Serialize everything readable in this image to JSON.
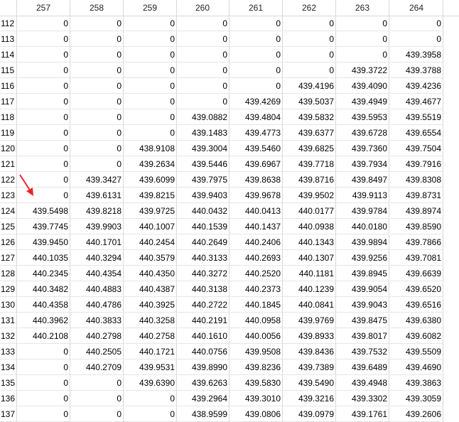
{
  "columns": [
    "257",
    "258",
    "259",
    "260",
    "261",
    "262",
    "263",
    "264"
  ],
  "rows": [
    {
      "index": "112",
      "values": [
        "0",
        "0",
        "0",
        "0",
        "0",
        "0",
        "0",
        "0"
      ]
    },
    {
      "index": "113",
      "values": [
        "0",
        "0",
        "0",
        "0",
        "0",
        "0",
        "0",
        "0"
      ]
    },
    {
      "index": "114",
      "values": [
        "0",
        "0",
        "0",
        "0",
        "0",
        "0",
        "0",
        "439.3958"
      ]
    },
    {
      "index": "115",
      "values": [
        "0",
        "0",
        "0",
        "0",
        "0",
        "0",
        "439.3722",
        "439.3788"
      ]
    },
    {
      "index": "116",
      "values": [
        "0",
        "0",
        "0",
        "0",
        "0",
        "439.4196",
        "439.4090",
        "439.4236"
      ]
    },
    {
      "index": "117",
      "values": [
        "0",
        "0",
        "0",
        "0",
        "439.4269",
        "439.5037",
        "439.4949",
        "439.4677"
      ]
    },
    {
      "index": "118",
      "values": [
        "0",
        "0",
        "0",
        "439.0882",
        "439.4804",
        "439.5832",
        "439.5953",
        "439.5519"
      ]
    },
    {
      "index": "119",
      "values": [
        "0",
        "0",
        "0",
        "439.1483",
        "439.4773",
        "439.6377",
        "439.6728",
        "439.6554"
      ]
    },
    {
      "index": "120",
      "values": [
        "0",
        "0",
        "438.9108",
        "439.3004",
        "439.5460",
        "439.6825",
        "439.7360",
        "439.7504"
      ]
    },
    {
      "index": "121",
      "values": [
        "0",
        "0",
        "439.2634",
        "439.5446",
        "439.6967",
        "439.7718",
        "439.7934",
        "439.7916"
      ]
    },
    {
      "index": "122",
      "values": [
        "0",
        "439.3427",
        "439.6099",
        "439.7975",
        "439.8638",
        "439.8716",
        "439.8497",
        "439.8308"
      ]
    },
    {
      "index": "123",
      "values": [
        "0",
        "439.6131",
        "439.8215",
        "439.9403",
        "439.9678",
        "439.9502",
        "439.9113",
        "439.8731"
      ]
    },
    {
      "index": "124",
      "values": [
        "439.5498",
        "439.8218",
        "439.9725",
        "440.0432",
        "440.0413",
        "440.0177",
        "439.9784",
        "439.8974"
      ]
    },
    {
      "index": "125",
      "values": [
        "439.7745",
        "439.9903",
        "440.1007",
        "440.1539",
        "440.1437",
        "440.0938",
        "440.0180",
        "439.8590"
      ]
    },
    {
      "index": "126",
      "values": [
        "439.9450",
        "440.1701",
        "440.2454",
        "440.2649",
        "440.2406",
        "440.1343",
        "439.9894",
        "439.7866"
      ]
    },
    {
      "index": "127",
      "values": [
        "440.1035",
        "440.3294",
        "440.3579",
        "440.3133",
        "440.2693",
        "440.1307",
        "439.9256",
        "439.7081"
      ]
    },
    {
      "index": "128",
      "values": [
        "440.2345",
        "440.4354",
        "440.4350",
        "440.3272",
        "440.2520",
        "440.1181",
        "439.8945",
        "439.6639"
      ]
    },
    {
      "index": "129",
      "values": [
        "440.3482",
        "440.4883",
        "440.4387",
        "440.3138",
        "440.2373",
        "440.1239",
        "439.9054",
        "439.6520"
      ]
    },
    {
      "index": "130",
      "values": [
        "440.4358",
        "440.4786",
        "440.3925",
        "440.2722",
        "440.1845",
        "440.0841",
        "439.9043",
        "439.6516"
      ]
    },
    {
      "index": "131",
      "values": [
        "440.3962",
        "440.3833",
        "440.3258",
        "440.2191",
        "440.0958",
        "439.9769",
        "439.8475",
        "439.6380"
      ]
    },
    {
      "index": "132",
      "values": [
        "440.2108",
        "440.2798",
        "440.2758",
        "440.1610",
        "440.0056",
        "439.8933",
        "439.8017",
        "439.6082"
      ]
    },
    {
      "index": "133",
      "values": [
        "0",
        "440.2505",
        "440.1721",
        "440.0756",
        "439.9508",
        "439.8436",
        "439.7532",
        "439.5509"
      ]
    },
    {
      "index": "134",
      "values": [
        "0",
        "440.2709",
        "439.9531",
        "439.8990",
        "439.8236",
        "439.7389",
        "439.6489",
        "439.4690"
      ]
    },
    {
      "index": "135",
      "values": [
        "0",
        "0",
        "439.6390",
        "439.6263",
        "439.5830",
        "439.5490",
        "439.4948",
        "439.3863"
      ]
    },
    {
      "index": "136",
      "values": [
        "0",
        "0",
        "0",
        "439.2964",
        "439.3010",
        "439.3216",
        "439.3302",
        "439.3059"
      ]
    },
    {
      "index": "137",
      "values": [
        "0",
        "0",
        "0",
        "438.9599",
        "439.0806",
        "439.0979",
        "439.1761",
        "439.2606"
      ]
    }
  ],
  "colors": {
    "grid_line": "#d9d9d9",
    "annotation_arrow": "#e8262a"
  },
  "icons": {
    "annotation": "red-arrow-icon"
  }
}
